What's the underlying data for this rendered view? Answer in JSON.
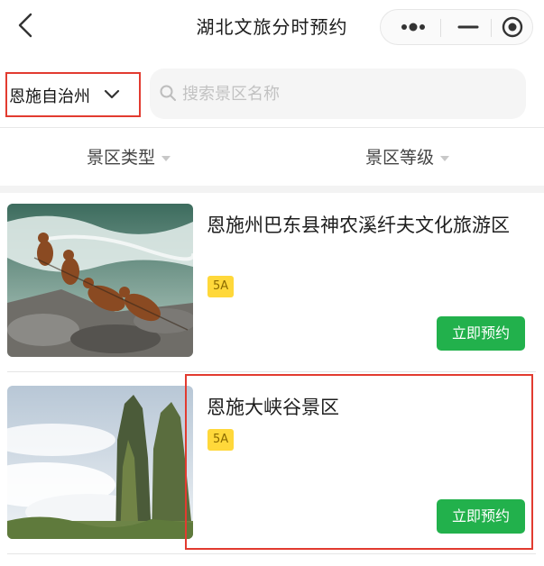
{
  "nav": {
    "title": "湖北文旅分时预约",
    "icons": {
      "back": "chevron-left-icon",
      "more": "more-dots-icon",
      "minimize": "minus-icon",
      "close": "target-circle-icon"
    }
  },
  "filter": {
    "region": "恩施自治州",
    "search_placeholder": "搜索景区名称"
  },
  "sort": {
    "type_label": "景区类型",
    "level_label": "景区等级"
  },
  "spots": [
    {
      "name": "恩施州巴东县神农溪纤夫文化旅游区",
      "level": "5A",
      "button": "立即预约"
    },
    {
      "name": "恩施大峡谷景区",
      "level": "5A",
      "button": "立即预约"
    }
  ],
  "colors": {
    "accent_green": "#22b14c",
    "badge_yellow": "#ffd83a",
    "annotation_red": "#e23b30"
  }
}
